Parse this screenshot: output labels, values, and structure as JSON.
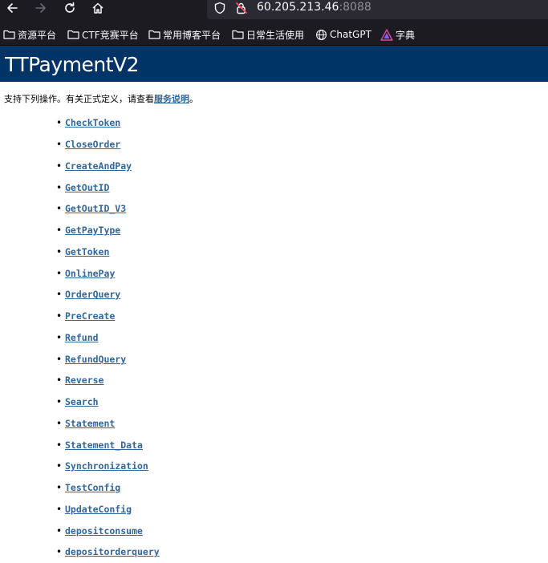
{
  "browser": {
    "url_host": "60.205.213.46",
    "url_port": ":8088",
    "bookmarks": [
      {
        "label": "资源平台",
        "icon": "folder-icon"
      },
      {
        "label": "CTF竞赛平台",
        "icon": "folder-icon"
      },
      {
        "label": "常用博客平台",
        "icon": "folder-icon"
      },
      {
        "label": "日常生活使用",
        "icon": "folder-icon"
      },
      {
        "label": "ChatGPT",
        "icon": "globe-icon"
      },
      {
        "label": "字典",
        "icon": "triangle-logo-icon"
      }
    ]
  },
  "page": {
    "title": "TTPaymentV2",
    "intro_text": "支持下列操作。有关正式定义，请查看",
    "intro_link": "服务说明",
    "intro_end": "。",
    "operations": [
      "CheckToken",
      "CloseOrder",
      "CreateAndPay",
      "GetOutID",
      "GetOutID_V3",
      "GetPayType",
      "GetToken",
      "OnlinePay",
      "OrderQuery",
      "PreCreate",
      "Refund",
      "RefundQuery",
      "Reverse",
      "Search",
      "Statement",
      "Statement_Data",
      "Synchronization",
      "TestConfig",
      "UpdateConfig",
      "depositconsume",
      "depositorderquery"
    ]
  },
  "colors": {
    "banner": "#003366",
    "link": "#336699",
    "chrome": "#1c1b22",
    "urlbar": "#2b2a33"
  }
}
